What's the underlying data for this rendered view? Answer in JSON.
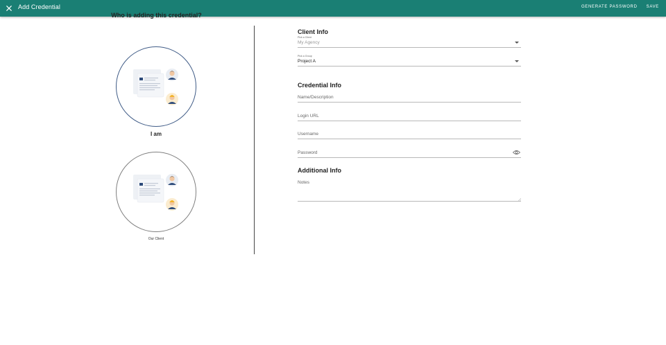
{
  "header": {
    "title": "Add Credential",
    "generate_password_label": "GENERATE PASSWORD",
    "save_label": "SAVE"
  },
  "left": {
    "heading": "Who is adding this credential?",
    "choices": [
      {
        "label": "I am",
        "selected": true
      },
      {
        "label": "Our Client",
        "selected": false
      }
    ]
  },
  "client_info": {
    "title": "Client Info",
    "client": {
      "label": "Pick a Client",
      "value": "My Agency"
    },
    "group": {
      "label": "Pick a Group",
      "value": "Project A"
    }
  },
  "credential_info": {
    "title": "Credential Info",
    "name_placeholder": "Name/Description",
    "login_url_placeholder": "Login URL",
    "username_placeholder": "Username",
    "password_placeholder": "Password"
  },
  "additional_info": {
    "title": "Additional Info",
    "notes_placeholder": "Notes"
  },
  "colors": {
    "header_bg": "#1a7f74",
    "selected_ring": "#3f5b86"
  },
  "icons": [
    "close-icon",
    "chevron-down-icon",
    "eye-icon"
  ]
}
